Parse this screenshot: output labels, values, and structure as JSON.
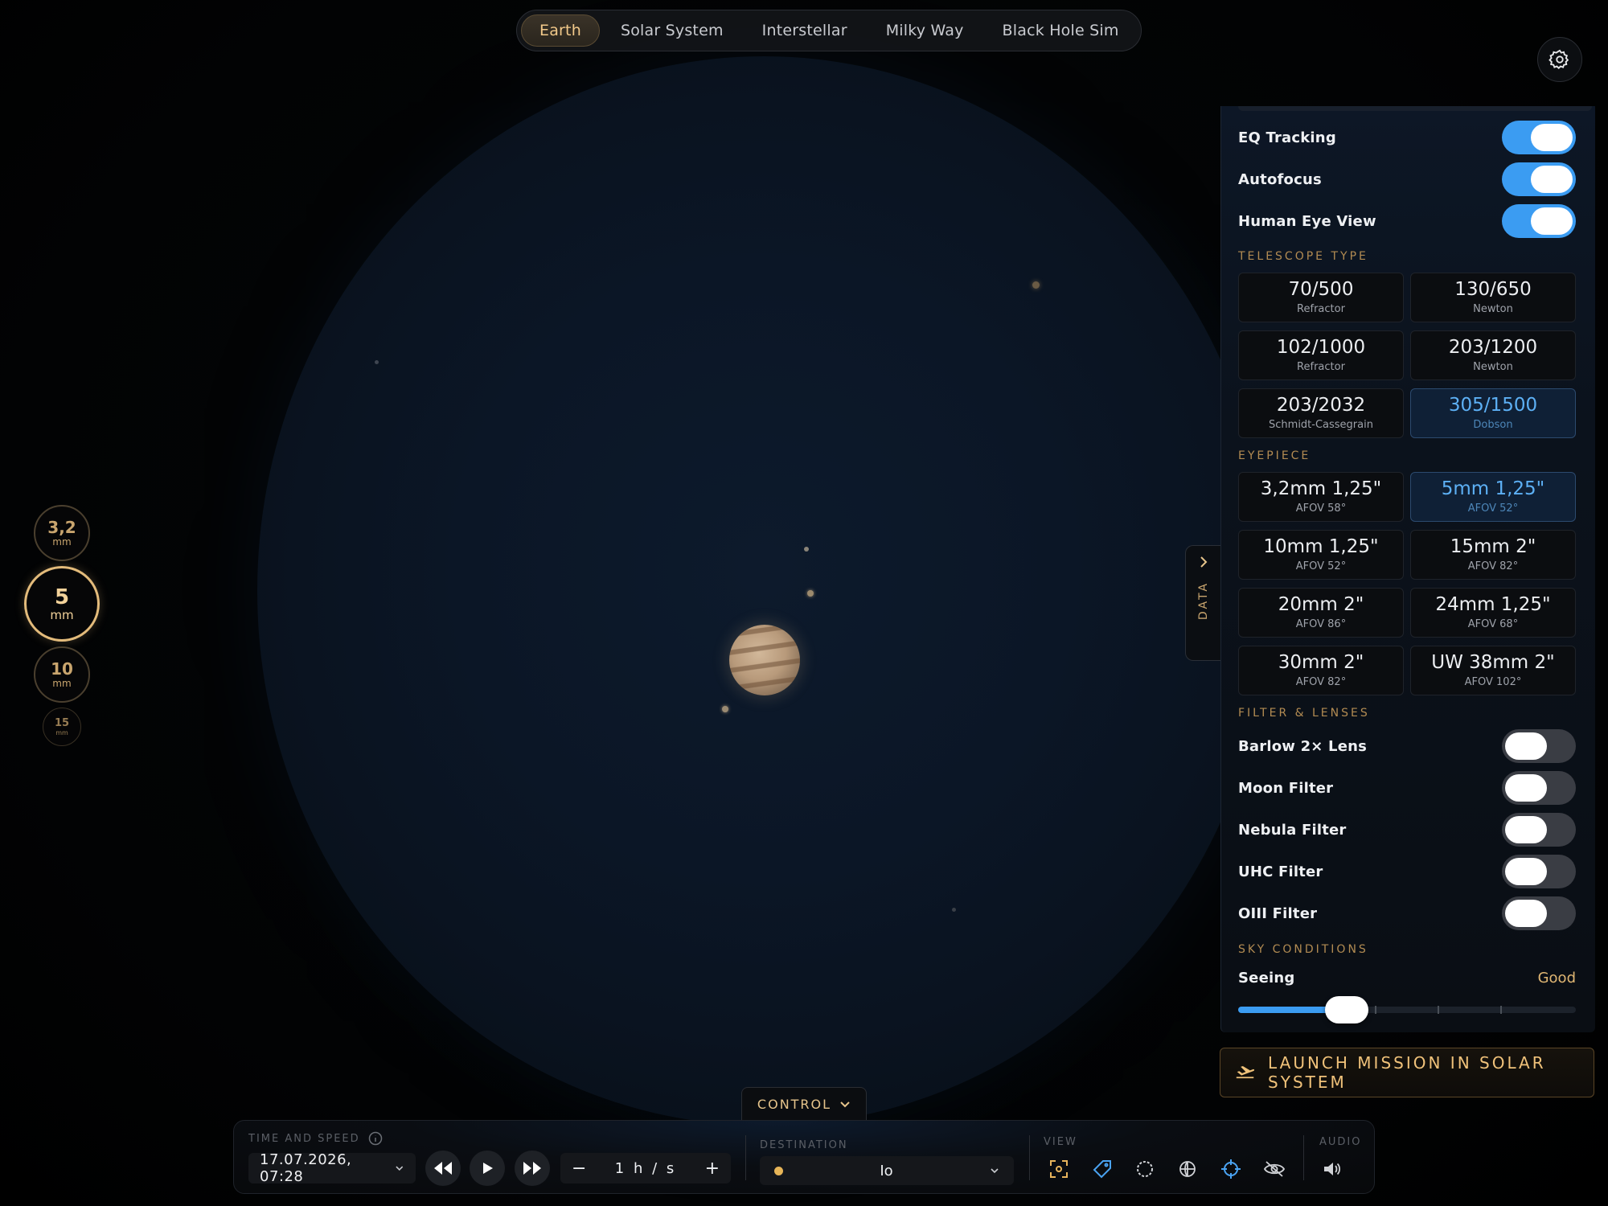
{
  "tabs": [
    {
      "label": "Earth",
      "active": true
    },
    {
      "label": "Solar System",
      "active": false
    },
    {
      "label": "Interstellar",
      "active": false
    },
    {
      "label": "Milky Way",
      "active": false
    },
    {
      "label": "Black Hole Sim",
      "active": false
    }
  ],
  "zoom_rail": [
    {
      "value": "3,2",
      "unit": "mm"
    },
    {
      "value": "5",
      "unit": "mm",
      "active": true
    },
    {
      "value": "10",
      "unit": "mm"
    },
    {
      "value": "15",
      "unit": "mm"
    }
  ],
  "panel": {
    "toggles_top": [
      {
        "label": "EQ Tracking",
        "on": true
      },
      {
        "label": "Autofocus",
        "on": true
      },
      {
        "label": "Human Eye View",
        "on": true
      }
    ],
    "telescope_type": {
      "title": "TELESCOPE TYPE",
      "options": [
        {
          "title": "70/500",
          "sub": "Refractor"
        },
        {
          "title": "130/650",
          "sub": "Newton"
        },
        {
          "title": "102/1000",
          "sub": "Refractor"
        },
        {
          "title": "203/1200",
          "sub": "Newton"
        },
        {
          "title": "203/2032",
          "sub": "Schmidt-Cassegrain"
        },
        {
          "title": "305/1500",
          "sub": "Dobson",
          "selected": true
        }
      ]
    },
    "eyepiece": {
      "title": "EYEPIECE",
      "options": [
        {
          "title": "3,2mm 1,25\"",
          "sub": "AFOV 58°"
        },
        {
          "title": "5mm 1,25\"",
          "sub": "AFOV 52°",
          "selected": true
        },
        {
          "title": "10mm 1,25\"",
          "sub": "AFOV 52°"
        },
        {
          "title": "15mm 2\"",
          "sub": "AFOV 82°"
        },
        {
          "title": "20mm 2\"",
          "sub": "AFOV 86°"
        },
        {
          "title": "24mm 1,25\"",
          "sub": "AFOV 68°"
        },
        {
          "title": "30mm 2\"",
          "sub": "AFOV 82°"
        },
        {
          "title": "UW 38mm 2\"",
          "sub": "AFOV 102°"
        }
      ]
    },
    "filters": {
      "title": "FILTER & LENSES",
      "items": [
        {
          "label": "Barlow 2× Lens",
          "on": false
        },
        {
          "label": "Moon Filter",
          "on": false
        },
        {
          "label": "Nebula Filter",
          "on": false
        },
        {
          "label": "UHC Filter",
          "on": false
        },
        {
          "label": "OIII Filter",
          "on": false
        }
      ]
    },
    "sky": {
      "title": "SKY CONDITIONS",
      "seeing_label": "Seeing",
      "seeing_value": "Good",
      "seeing_level": 0.24
    },
    "launch_label": "LAUNCH MISSION IN SOLAR SYSTEM",
    "data_tab_label": "DATA"
  },
  "control": {
    "toggle_label": "CONTROL",
    "time_caption": "TIME AND SPEED",
    "datetime": "17.07.2026, 07:28",
    "speed": "1 h / s",
    "speed_minus": "−",
    "speed_plus": "+",
    "destination_caption": "DESTINATION",
    "destination": "Io",
    "view_caption": "VIEW",
    "audio_caption": "AUDIO"
  },
  "colors": {
    "accent_gold": "#e3bb7b",
    "accent_blue": "#3b9cf2",
    "toggle_off": "#3a3d44"
  },
  "icons": [
    "gear-icon",
    "info-icon",
    "rewind-icon",
    "play-icon",
    "fast-forward-icon",
    "chevron-down-icon",
    "focus-frame-icon",
    "tag-icon",
    "circle-icon",
    "globe-icon",
    "crosshair-icon",
    "eye-off-icon",
    "speaker-icon",
    "launch-plane-icon",
    "chevron-right-icon"
  ]
}
